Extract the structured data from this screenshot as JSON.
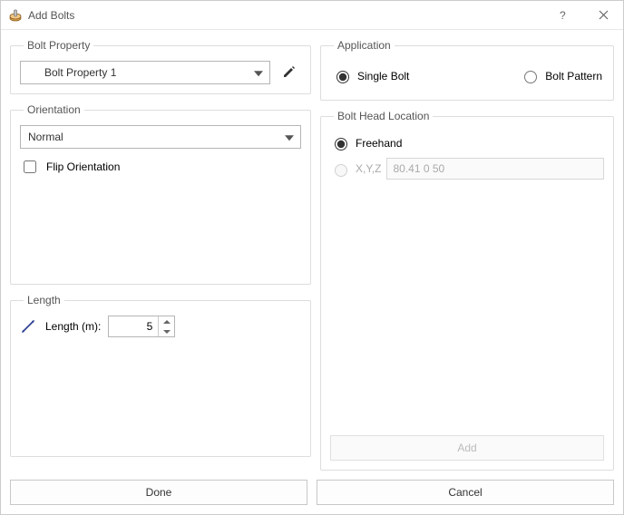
{
  "window": {
    "title": "Add Bolts"
  },
  "groups": {
    "bolt_property": "Bolt Property",
    "orientation": "Orientation",
    "length": "Length",
    "application": "Application",
    "head_location": "Bolt Head Location"
  },
  "bolt_property": {
    "selected": "Bolt Property 1"
  },
  "orientation": {
    "selected": "Normal",
    "flip_label": "Flip Orientation",
    "flip_checked": false
  },
  "length": {
    "label": "Length (m):",
    "value": "5"
  },
  "application": {
    "single_label": "Single Bolt",
    "pattern_label": "Bolt Pattern",
    "selected": "single"
  },
  "head_location": {
    "freehand_label": "Freehand",
    "xyz_label": "X,Y,Z",
    "xyz_value": "80.41 0 50",
    "selected": "freehand",
    "add_label": "Add"
  },
  "footer": {
    "done": "Done",
    "cancel": "Cancel"
  }
}
